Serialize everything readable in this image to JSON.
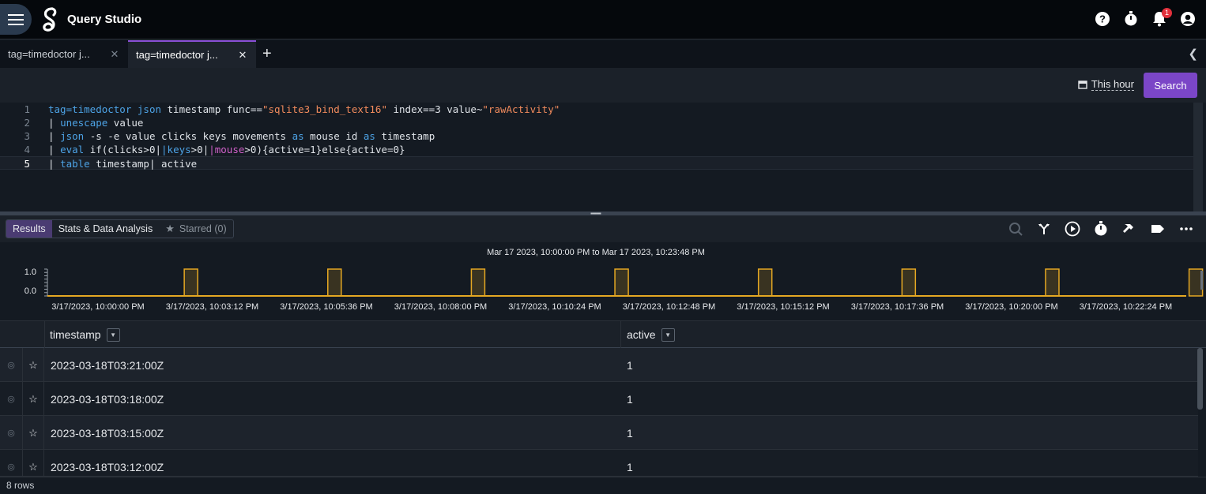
{
  "app": {
    "title": "Query Studio",
    "notification_count": "1"
  },
  "tabs": [
    {
      "label": "tag=timedoctor j..."
    },
    {
      "label": "tag=timedoctor j..."
    }
  ],
  "search": {
    "time_range": "This hour",
    "button": "Search"
  },
  "editor": {
    "line_numbers": [
      "1",
      "2",
      "3",
      "4",
      "5"
    ],
    "lines": [
      [
        {
          "t": "tag=timedoctor ",
          "c": "kw"
        },
        {
          "t": "json",
          "c": "kw"
        },
        {
          "t": " timestamp func==",
          "c": ""
        },
        {
          "t": "\"sqlite3_bind_text16\"",
          "c": "str"
        },
        {
          "t": " index==3 value~",
          "c": ""
        },
        {
          "t": "\"rawActivity\"",
          "c": "str"
        }
      ],
      [
        {
          "t": "| ",
          "c": ""
        },
        {
          "t": "unescape",
          "c": "kw"
        },
        {
          "t": " value",
          "c": ""
        }
      ],
      [
        {
          "t": "| ",
          "c": ""
        },
        {
          "t": "json",
          "c": "kw"
        },
        {
          "t": " -s -e value clicks keys movements ",
          "c": ""
        },
        {
          "t": "as",
          "c": "kw"
        },
        {
          "t": " mouse id ",
          "c": ""
        },
        {
          "t": "as",
          "c": "kw"
        },
        {
          "t": " timestamp",
          "c": ""
        }
      ],
      [
        {
          "t": "| ",
          "c": ""
        },
        {
          "t": "eval",
          "c": "kw"
        },
        {
          "t": " if(clicks>0|",
          "c": ""
        },
        {
          "t": "|keys",
          "c": "kw"
        },
        {
          "t": ">0|",
          "c": ""
        },
        {
          "t": "|mouse",
          "c": "pink"
        },
        {
          "t": ">0){active=1}else{active=0}",
          "c": ""
        }
      ],
      [
        {
          "t": "| ",
          "c": ""
        },
        {
          "t": "table",
          "c": "kw"
        },
        {
          "t": " timestamp",
          "c": ""
        },
        {
          "t": "|",
          "c": ""
        },
        {
          "t": " active",
          "c": ""
        }
      ]
    ]
  },
  "results_tabs": {
    "results": "Results",
    "stats": "Stats & Data Analysis",
    "starred": "Starred (0)"
  },
  "chart_data": {
    "type": "bar",
    "title": "Mar 17 2023, 10:00:00 PM to Mar 17 2023, 10:23:48 PM",
    "y_ticks": [
      "1.0",
      "0.0"
    ],
    "ylim": [
      0,
      1
    ],
    "x_ticks": [
      "3/17/2023, 10:00:00 PM",
      "3/17/2023, 10:03:12 PM",
      "3/17/2023, 10:05:36 PM",
      "3/17/2023, 10:08:00 PM",
      "3/17/2023, 10:10:24 PM",
      "3/17/2023, 10:12:48 PM",
      "3/17/2023, 10:15:12 PM",
      "3/17/2023, 10:17:36 PM",
      "3/17/2023, 10:20:00 PM",
      "3/17/2023, 10:22:24 PM"
    ],
    "bars_x": [
      "10:00",
      "10:03",
      "10:06",
      "10:09",
      "10:12",
      "10:15",
      "10:18",
      "10:21"
    ],
    "values": [
      1,
      1,
      1,
      1,
      1,
      1,
      1,
      1
    ],
    "color": "#e5a823"
  },
  "table": {
    "columns": [
      "timestamp",
      "active"
    ],
    "rows": [
      [
        "2023-03-18T03:21:00Z",
        "1"
      ],
      [
        "2023-03-18T03:18:00Z",
        "1"
      ],
      [
        "2023-03-18T03:15:00Z",
        "1"
      ],
      [
        "2023-03-18T03:12:00Z",
        "1"
      ]
    ],
    "footer": "8 rows"
  }
}
